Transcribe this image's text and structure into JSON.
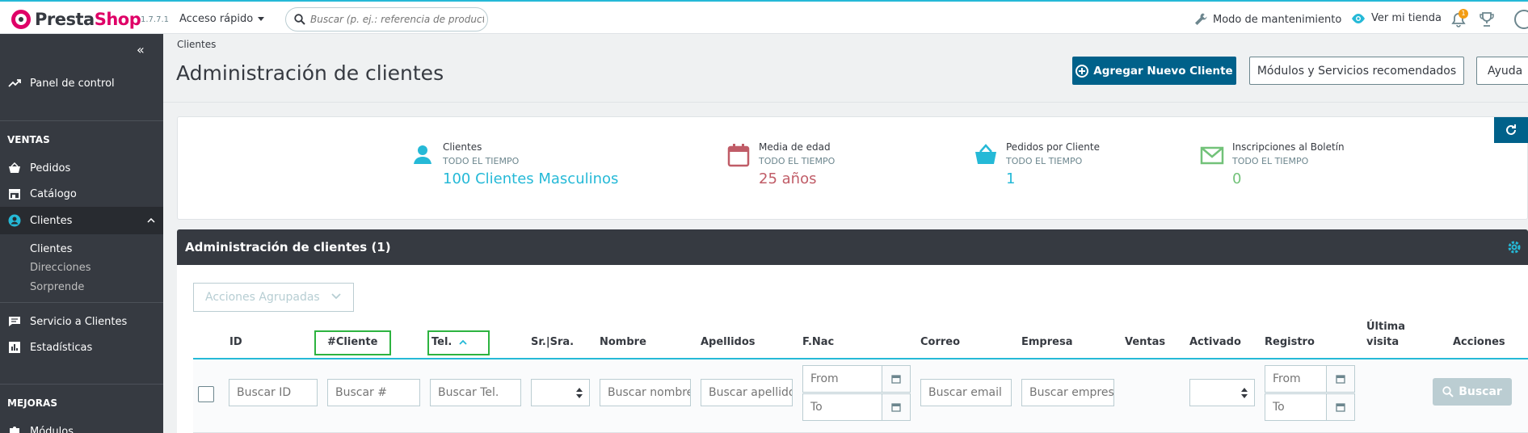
{
  "app": {
    "brand_presta": "Presta",
    "brand_shop": "Shop",
    "version": "1.7.7.1",
    "quick_access": "Acceso rápido",
    "search_placeholder": "Buscar (p. ej.: referencia de producto, n",
    "maintenance": "Modo de mantenimiento",
    "view_store": "Ver mi tienda",
    "notifications_count": "1"
  },
  "sidebar": {
    "dashboard": "Panel de control",
    "section_sales": "VENTAS",
    "orders": "Pedidos",
    "catalog": "Catálogo",
    "customers": "Clientes",
    "sub_customers": "Clientes",
    "sub_addresses": "Direcciones",
    "sub_surprise": "Sorprende",
    "customer_service": "Servicio a Clientes",
    "stats": "Estadísticas",
    "section_improvements": "MEJORAS",
    "modules": "Módulos"
  },
  "header": {
    "breadcrumb": "Clientes",
    "title": "Administración de clientes",
    "add_button": "Agregar Nuevo Cliente",
    "modules_button": "Módulos y Servicios recomendados",
    "help_button": "Ayuda"
  },
  "kpis": [
    {
      "label": "Clientes",
      "sub": "TODO EL TIEMPO",
      "value": "100 Clientes Masculinos",
      "color": "#25b9d7",
      "icon": "user-icon"
    },
    {
      "label": "Media de edad",
      "sub": "TODO EL TIEMPO",
      "value": "25 años",
      "color": "#c05c67",
      "icon": "calendar-icon"
    },
    {
      "label": "Pedidos por Cliente",
      "sub": "TODO EL TIEMPO",
      "value": "1",
      "color": "#25b9d7",
      "icon": "basket-icon"
    },
    {
      "label": "Inscripciones al Boletín",
      "sub": "TODO EL TIEMPO",
      "value": "0",
      "color": "#72c279",
      "icon": "envelope-icon"
    }
  ],
  "list": {
    "title": "Administración de clientes (1)",
    "bulk_actions": "Acciones Agrupadas",
    "columns": {
      "id": "ID",
      "customer_no": "#Cliente",
      "phone": "Tel.",
      "title": "Sr.|Sra.",
      "first_name": "Nombre",
      "last_name": "Apellidos",
      "birthday": "F.Nac",
      "email": "Correo",
      "company": "Empresa",
      "sales": "Ventas",
      "active": "Activado",
      "registration": "Registro",
      "last_visit_1": "Última",
      "last_visit_2": "visita",
      "actions": "Acciones"
    },
    "filters": {
      "id": "Buscar ID",
      "customer_no": "Buscar #",
      "phone": "Buscar Tel.",
      "first_name": "Buscar nombre",
      "last_name": "Buscar apellido",
      "from": "From",
      "to": "To",
      "email": "Buscar email",
      "company": "Buscar empresa"
    },
    "search_button": "Buscar"
  },
  "colors": {
    "primary": "#00618a",
    "sidebar": "#363a41",
    "accent": "#25b9d7",
    "highlight": "#2db340"
  }
}
